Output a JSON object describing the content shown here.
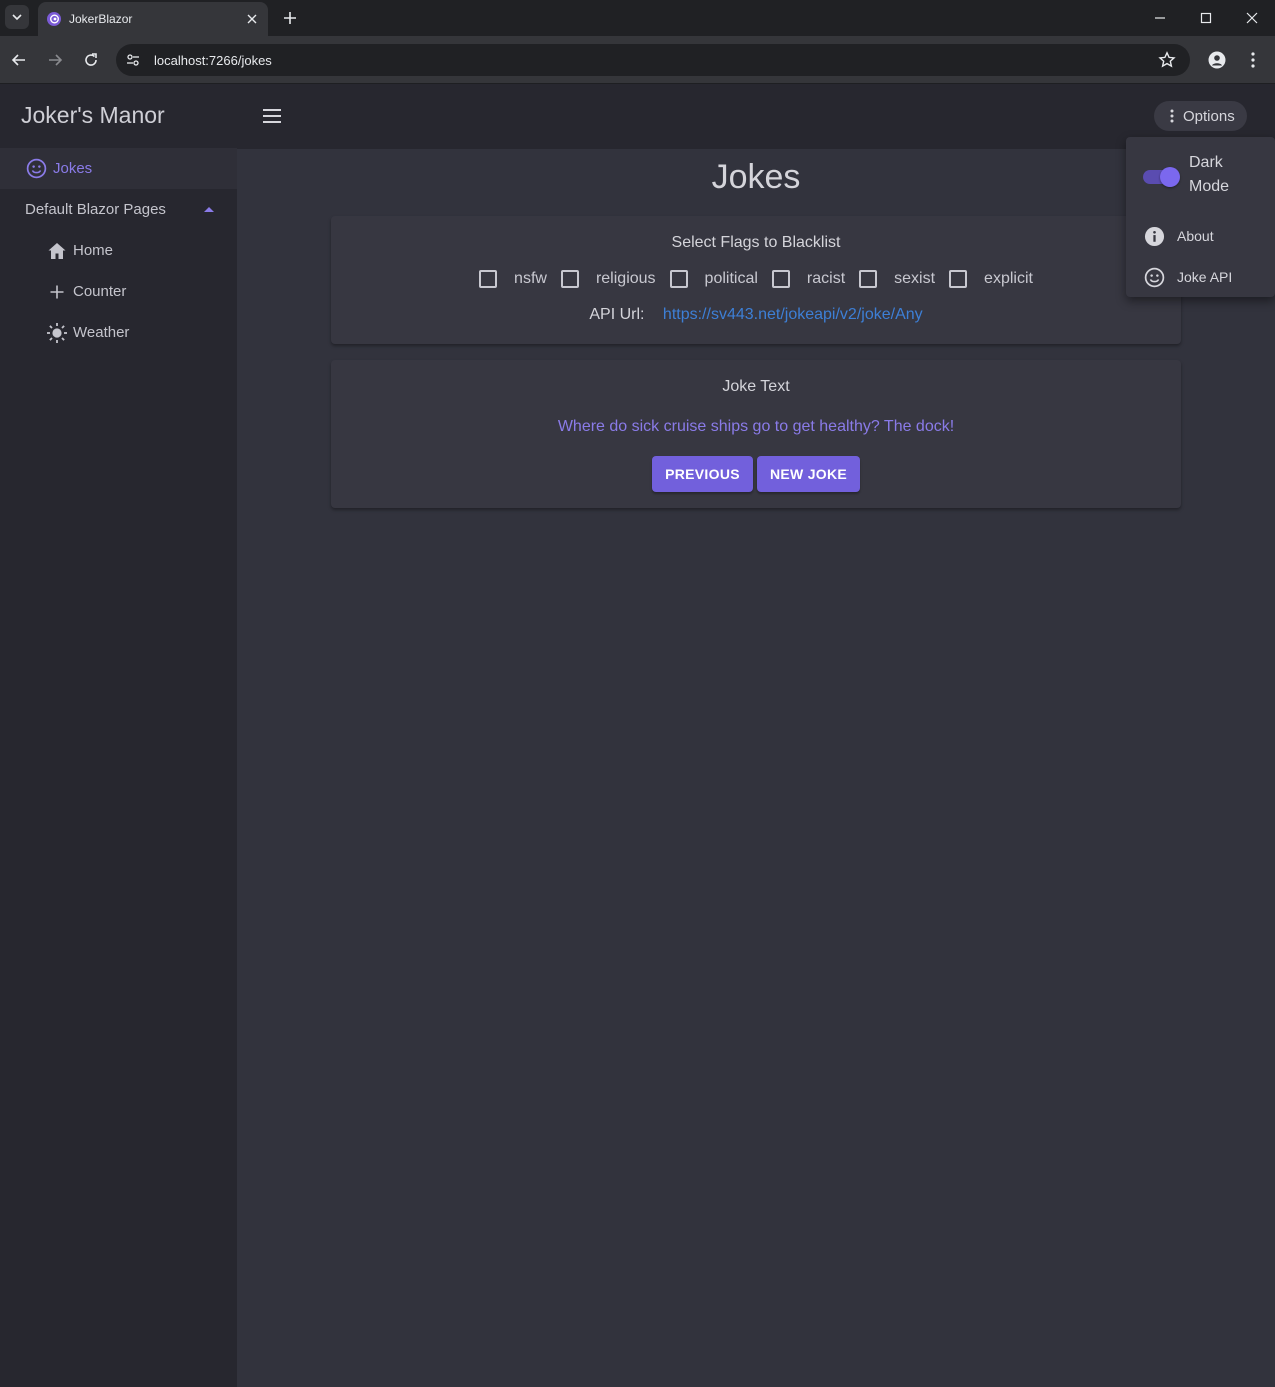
{
  "browser": {
    "tab_title": "JokerBlazor",
    "url": "localhost:7266/jokes"
  },
  "app": {
    "brand": "Joker's Manor",
    "options_label": "Options",
    "accent": "#7b68ee"
  },
  "nav": {
    "jokes": "Jokes",
    "group": "Default Blazor Pages",
    "home": "Home",
    "counter": "Counter",
    "weather": "Weather"
  },
  "page": {
    "title": "Jokes"
  },
  "blacklist": {
    "title": "Select Flags to Blacklist",
    "flags": [
      "nsfw",
      "religious",
      "political",
      "racist",
      "sexist",
      "explicit"
    ],
    "api_label": "API Url:",
    "api_url": "https://sv443.net/jokeapi/v2/joke/Any"
  },
  "joke": {
    "title": "Joke Text",
    "text": "Where do sick cruise ships go to get healthy? The dock!",
    "previous_label": "PREVIOUS",
    "new_label": "NEW JOKE"
  },
  "options_menu": {
    "dark_mode_label": "Dark Mode",
    "dark_mode_on": true,
    "about_label": "About",
    "joke_api_label": "Joke API"
  }
}
